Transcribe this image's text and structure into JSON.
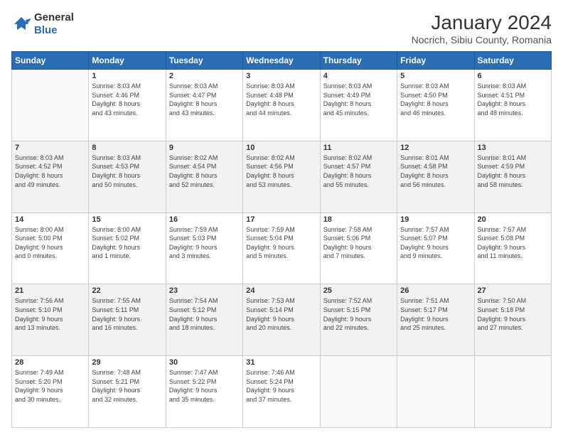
{
  "logo": {
    "line1": "General",
    "line2": "Blue"
  },
  "title": "January 2024",
  "subtitle": "Nocrich, Sibiu County, Romania",
  "weekdays": [
    "Sunday",
    "Monday",
    "Tuesday",
    "Wednesday",
    "Thursday",
    "Friday",
    "Saturday"
  ],
  "weeks": [
    [
      {
        "day": "",
        "info": ""
      },
      {
        "day": "1",
        "info": "Sunrise: 8:03 AM\nSunset: 4:46 PM\nDaylight: 8 hours\nand 43 minutes."
      },
      {
        "day": "2",
        "info": "Sunrise: 8:03 AM\nSunset: 4:47 PM\nDaylight: 8 hours\nand 43 minutes."
      },
      {
        "day": "3",
        "info": "Sunrise: 8:03 AM\nSunset: 4:48 PM\nDaylight: 8 hours\nand 44 minutes."
      },
      {
        "day": "4",
        "info": "Sunrise: 8:03 AM\nSunset: 4:49 PM\nDaylight: 8 hours\nand 45 minutes."
      },
      {
        "day": "5",
        "info": "Sunrise: 8:03 AM\nSunset: 4:50 PM\nDaylight: 8 hours\nand 46 minutes."
      },
      {
        "day": "6",
        "info": "Sunrise: 8:03 AM\nSunset: 4:51 PM\nDaylight: 8 hours\nand 48 minutes."
      }
    ],
    [
      {
        "day": "7",
        "info": "Sunrise: 8:03 AM\nSunset: 4:52 PM\nDaylight: 8 hours\nand 49 minutes."
      },
      {
        "day": "8",
        "info": "Sunrise: 8:03 AM\nSunset: 4:53 PM\nDaylight: 8 hours\nand 50 minutes."
      },
      {
        "day": "9",
        "info": "Sunrise: 8:02 AM\nSunset: 4:54 PM\nDaylight: 8 hours\nand 52 minutes."
      },
      {
        "day": "10",
        "info": "Sunrise: 8:02 AM\nSunset: 4:56 PM\nDaylight: 8 hours\nand 53 minutes."
      },
      {
        "day": "11",
        "info": "Sunrise: 8:02 AM\nSunset: 4:57 PM\nDaylight: 8 hours\nand 55 minutes."
      },
      {
        "day": "12",
        "info": "Sunrise: 8:01 AM\nSunset: 4:58 PM\nDaylight: 8 hours\nand 56 minutes."
      },
      {
        "day": "13",
        "info": "Sunrise: 8:01 AM\nSunset: 4:59 PM\nDaylight: 8 hours\nand 58 minutes."
      }
    ],
    [
      {
        "day": "14",
        "info": "Sunrise: 8:00 AM\nSunset: 5:00 PM\nDaylight: 9 hours\nand 0 minutes."
      },
      {
        "day": "15",
        "info": "Sunrise: 8:00 AM\nSunset: 5:02 PM\nDaylight: 9 hours\nand 1 minute."
      },
      {
        "day": "16",
        "info": "Sunrise: 7:59 AM\nSunset: 5:03 PM\nDaylight: 9 hours\nand 3 minutes."
      },
      {
        "day": "17",
        "info": "Sunrise: 7:59 AM\nSunset: 5:04 PM\nDaylight: 9 hours\nand 5 minutes."
      },
      {
        "day": "18",
        "info": "Sunrise: 7:58 AM\nSunset: 5:06 PM\nDaylight: 9 hours\nand 7 minutes."
      },
      {
        "day": "19",
        "info": "Sunrise: 7:57 AM\nSunset: 5:07 PM\nDaylight: 9 hours\nand 9 minutes."
      },
      {
        "day": "20",
        "info": "Sunrise: 7:57 AM\nSunset: 5:08 PM\nDaylight: 9 hours\nand 11 minutes."
      }
    ],
    [
      {
        "day": "21",
        "info": "Sunrise: 7:56 AM\nSunset: 5:10 PM\nDaylight: 9 hours\nand 13 minutes."
      },
      {
        "day": "22",
        "info": "Sunrise: 7:55 AM\nSunset: 5:11 PM\nDaylight: 9 hours\nand 16 minutes."
      },
      {
        "day": "23",
        "info": "Sunrise: 7:54 AM\nSunset: 5:12 PM\nDaylight: 9 hours\nand 18 minutes."
      },
      {
        "day": "24",
        "info": "Sunrise: 7:53 AM\nSunset: 5:14 PM\nDaylight: 9 hours\nand 20 minutes."
      },
      {
        "day": "25",
        "info": "Sunrise: 7:52 AM\nSunset: 5:15 PM\nDaylight: 9 hours\nand 22 minutes."
      },
      {
        "day": "26",
        "info": "Sunrise: 7:51 AM\nSunset: 5:17 PM\nDaylight: 9 hours\nand 25 minutes."
      },
      {
        "day": "27",
        "info": "Sunrise: 7:50 AM\nSunset: 5:18 PM\nDaylight: 9 hours\nand 27 minutes."
      }
    ],
    [
      {
        "day": "28",
        "info": "Sunrise: 7:49 AM\nSunset: 5:20 PM\nDaylight: 9 hours\nand 30 minutes."
      },
      {
        "day": "29",
        "info": "Sunrise: 7:48 AM\nSunset: 5:21 PM\nDaylight: 9 hours\nand 32 minutes."
      },
      {
        "day": "30",
        "info": "Sunrise: 7:47 AM\nSunset: 5:22 PM\nDaylight: 9 hours\nand 35 minutes."
      },
      {
        "day": "31",
        "info": "Sunrise: 7:46 AM\nSunset: 5:24 PM\nDaylight: 9 hours\nand 37 minutes."
      },
      {
        "day": "",
        "info": ""
      },
      {
        "day": "",
        "info": ""
      },
      {
        "day": "",
        "info": ""
      }
    ]
  ]
}
